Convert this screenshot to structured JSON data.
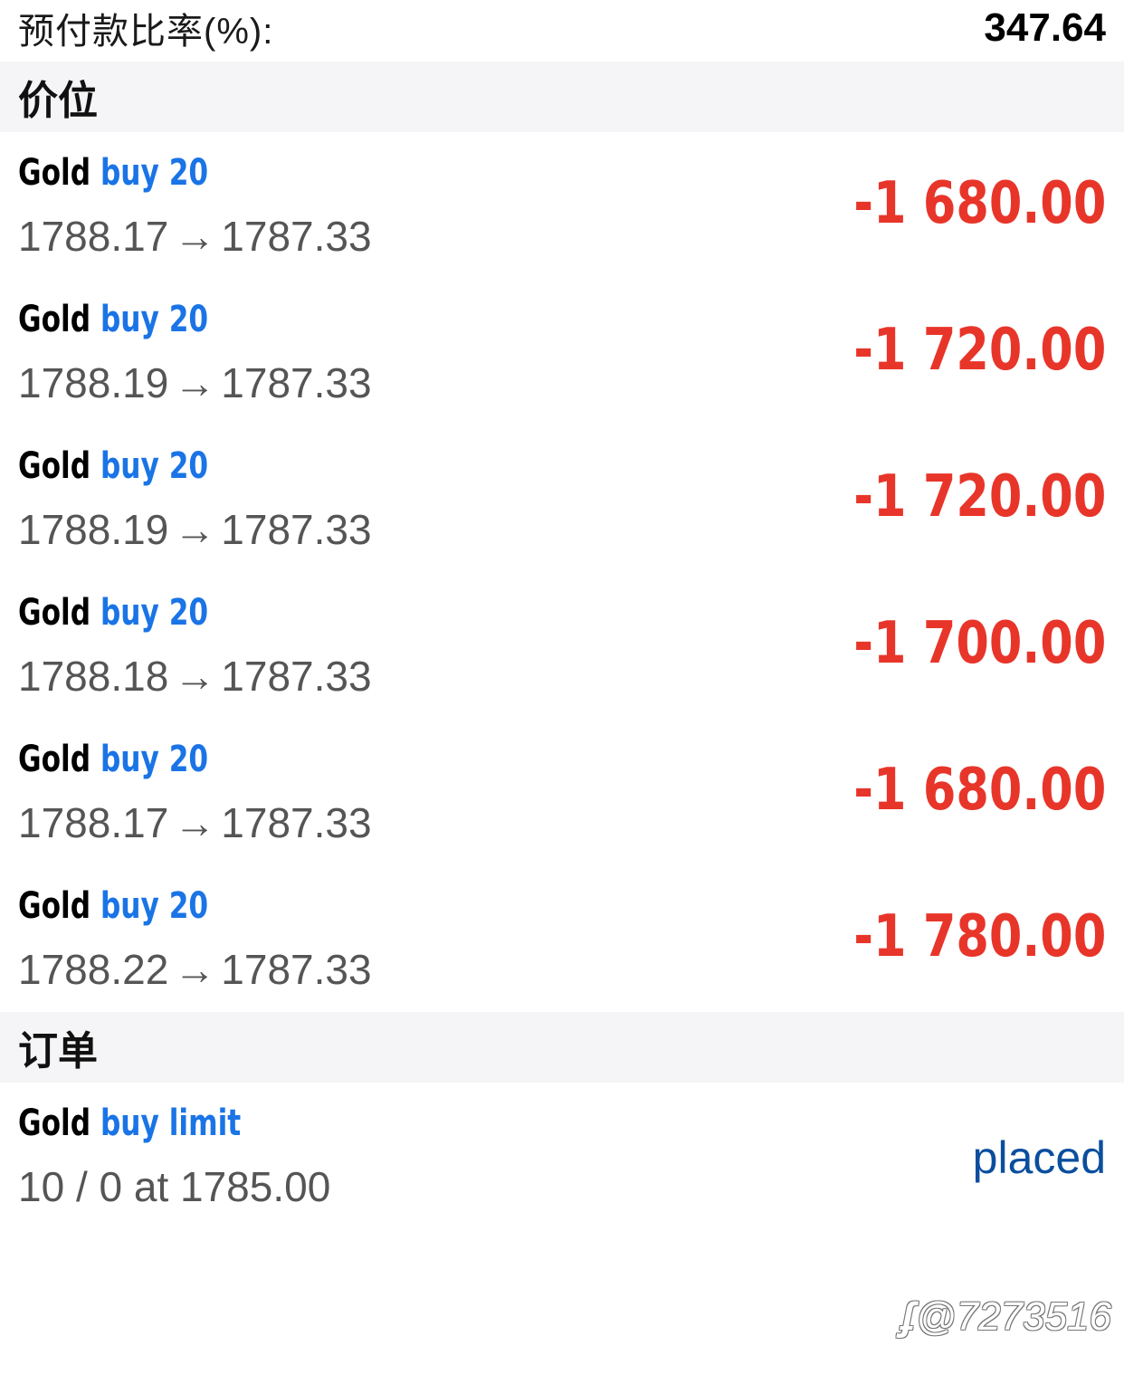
{
  "margin_level": {
    "label": "预付款比率(%):",
    "value": "347.64"
  },
  "positions_section": {
    "header": "价位",
    "items": [
      {
        "symbol": "Gold",
        "side": "buy 20",
        "open_price": "1788.17",
        "arrow": "→",
        "current_price": "1787.33",
        "profit": "-1 680.00"
      },
      {
        "symbol": "Gold",
        "side": "buy 20",
        "open_price": "1788.19",
        "arrow": "→",
        "current_price": "1787.33",
        "profit": "-1 720.00"
      },
      {
        "symbol": "Gold",
        "side": "buy 20",
        "open_price": "1788.19",
        "arrow": "→",
        "current_price": "1787.33",
        "profit": "-1 720.00"
      },
      {
        "symbol": "Gold",
        "side": "buy 20",
        "open_price": "1788.18",
        "arrow": "→",
        "current_price": "1787.33",
        "profit": "-1 700.00"
      },
      {
        "symbol": "Gold",
        "side": "buy 20",
        "open_price": "1788.17",
        "arrow": "→",
        "current_price": "1787.33",
        "profit": "-1 680.00"
      },
      {
        "symbol": "Gold",
        "side": "buy 20",
        "open_price": "1788.22",
        "arrow": "→",
        "current_price": "1787.33",
        "profit": "-1 780.00"
      }
    ]
  },
  "orders_section": {
    "header": "订单",
    "items": [
      {
        "symbol": "Gold",
        "type": "buy limit",
        "details": "10 / 0 at 1785.00",
        "status": "placed"
      }
    ]
  },
  "watermark": {
    "logo": "ʄ",
    "text": "@7273516"
  },
  "colors": {
    "profit_negative": "#e8352a",
    "side_blue": "#1a74e6",
    "status_blue": "#0b4e9e",
    "header_bg": "#f5f5f7"
  }
}
